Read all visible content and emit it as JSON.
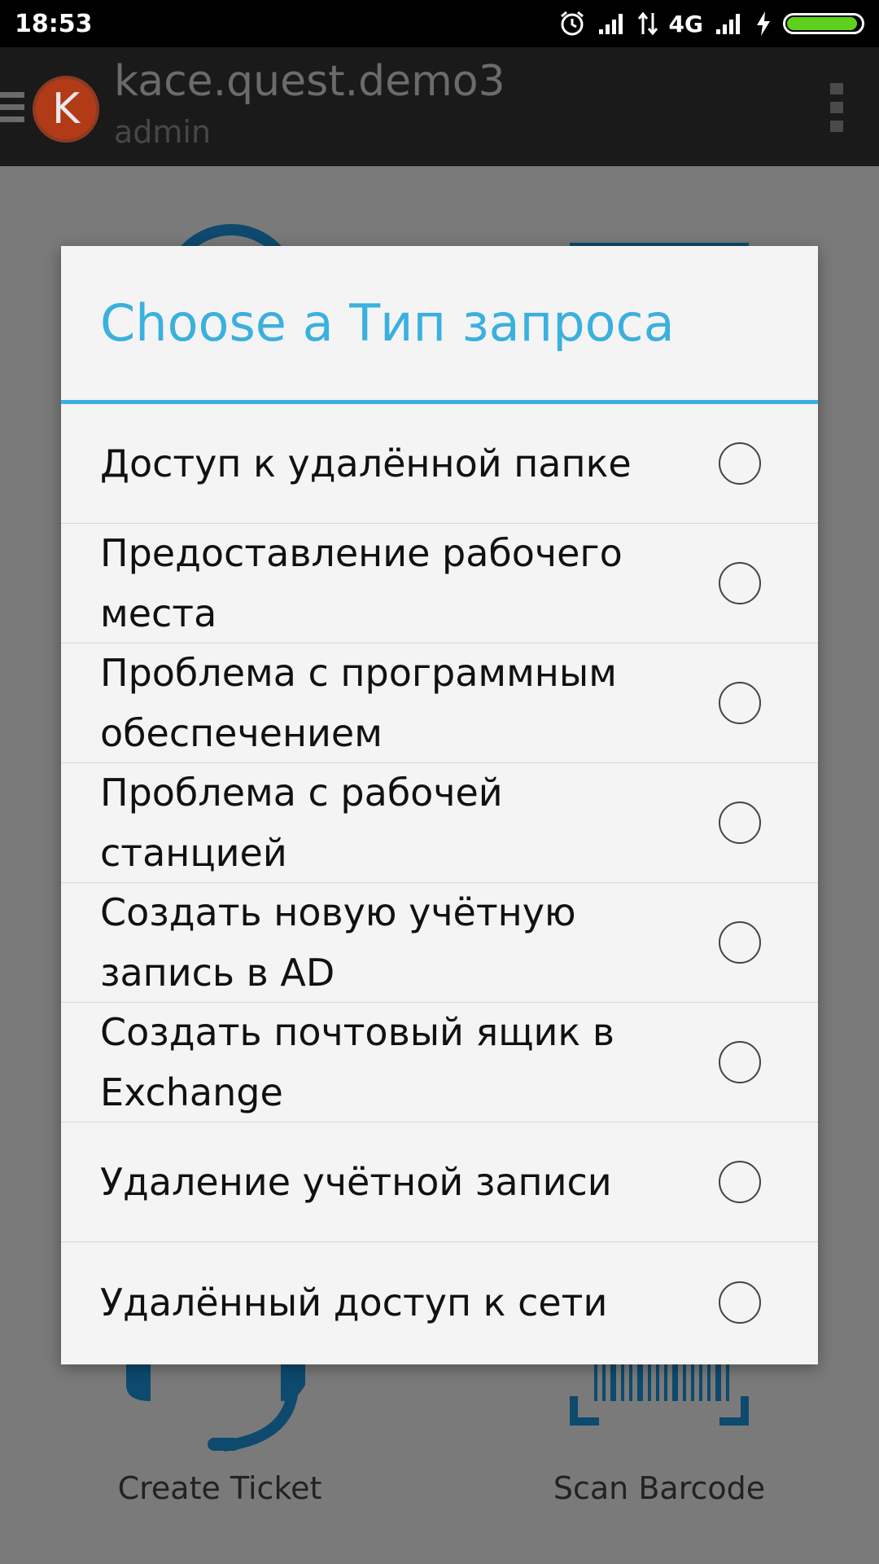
{
  "status_bar": {
    "time": "18:53",
    "network": "4G",
    "battery_level": 0.95,
    "icons": [
      "alarm-icon",
      "signal-icon",
      "data-transfer-icon",
      "charging-icon",
      "battery-icon"
    ]
  },
  "action_bar": {
    "title": "kace.quest.demo3",
    "subtitle": "admin",
    "avatar_letter": "K",
    "icons": [
      "menu-icon",
      "overflow-menu-icon"
    ]
  },
  "background": {
    "tiles": [
      {
        "label": "Create Ticket",
        "icon": "headset-icon"
      },
      {
        "label": "Scan Barcode",
        "icon": "barcode-icon"
      }
    ]
  },
  "dialog": {
    "title": "Choose a Тип запроса",
    "options": [
      {
        "label": "Доступ к удалённой папке",
        "selected": false
      },
      {
        "label": "Предоставление рабочего места",
        "selected": false
      },
      {
        "label": "Проблема с программным обеспечением",
        "selected": false
      },
      {
        "label": "Проблема с рабочей станцией",
        "selected": false
      },
      {
        "label": "Создать новую учётную запись в AD",
        "selected": false
      },
      {
        "label": "Создать почтовый ящик в Exchange",
        "selected": false
      },
      {
        "label": "Удаление учётной записи",
        "selected": false
      },
      {
        "label": "Удалённый доступ к сети",
        "selected": false
      }
    ]
  },
  "colors": {
    "accent": "#3ab0df",
    "status_bar": "#000000",
    "action_bar": "#1a1a1a",
    "dim_overlay": "#7a7a7a",
    "dialog_bg": "#f4f4f4",
    "battery": "#5fd01c",
    "icon_blue": "#0d4a6e"
  }
}
